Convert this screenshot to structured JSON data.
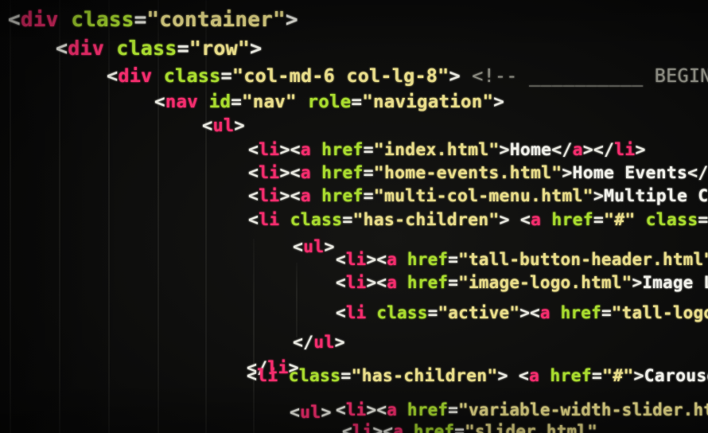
{
  "code_lines": [
    [
      [
        "br",
        "<"
      ],
      [
        "tag",
        "div"
      ],
      [
        "txt",
        " "
      ],
      [
        "attr",
        "class"
      ],
      [
        "br",
        "="
      ],
      [
        "str",
        "\"container\""
      ],
      [
        "br",
        ">"
      ]
    ],
    [
      [
        "br",
        "<"
      ],
      [
        "tag",
        "div"
      ],
      [
        "txt",
        " "
      ],
      [
        "attr",
        "class"
      ],
      [
        "br",
        "="
      ],
      [
        "str",
        "\"row\""
      ],
      [
        "br",
        ">"
      ]
    ],
    [
      [
        "br",
        "<"
      ],
      [
        "tag",
        "div"
      ],
      [
        "txt",
        " "
      ],
      [
        "attr",
        "class"
      ],
      [
        "br",
        "="
      ],
      [
        "str",
        "\"col-md-6 col-lg-8\""
      ],
      [
        "br",
        ">"
      ],
      [
        "txt",
        " "
      ],
      [
        "com",
        "<!-- __________ BEGIN NAVIGATION"
      ]
    ],
    [
      [
        "br",
        "<"
      ],
      [
        "tag",
        "nav"
      ],
      [
        "txt",
        " "
      ],
      [
        "attr",
        "id"
      ],
      [
        "br",
        "="
      ],
      [
        "str",
        "\"nav\""
      ],
      [
        "txt",
        " "
      ],
      [
        "attr",
        "role"
      ],
      [
        "br",
        "="
      ],
      [
        "str",
        "\"navigation\""
      ],
      [
        "br",
        ">"
      ]
    ],
    [
      [
        "br",
        "<"
      ],
      [
        "tag",
        "ul"
      ],
      [
        "br",
        ">"
      ]
    ],
    [
      [
        "br",
        "<"
      ],
      [
        "tag",
        "li"
      ],
      [
        "br",
        "><"
      ],
      [
        "tag",
        "a"
      ],
      [
        "txt",
        " "
      ],
      [
        "attr",
        "href"
      ],
      [
        "br",
        "="
      ],
      [
        "str",
        "\"index.html\""
      ],
      [
        "br",
        ">"
      ],
      [
        "txt",
        "Home"
      ],
      [
        "br",
        "</"
      ],
      [
        "tag",
        "a"
      ],
      [
        "br",
        "></"
      ],
      [
        "tag",
        "li"
      ],
      [
        "br",
        ">"
      ]
    ],
    [
      [
        "br",
        "<"
      ],
      [
        "tag",
        "li"
      ],
      [
        "br",
        "><"
      ],
      [
        "tag",
        "a"
      ],
      [
        "txt",
        " "
      ],
      [
        "attr",
        "href"
      ],
      [
        "br",
        "="
      ],
      [
        "str",
        "\"home-events.html\""
      ],
      [
        "br",
        ">"
      ],
      [
        "txt",
        "Home Events"
      ],
      [
        "br",
        "</"
      ],
      [
        "tag",
        "a"
      ],
      [
        "br",
        ">"
      ]
    ],
    [
      [
        "br",
        "<"
      ],
      [
        "tag",
        "li"
      ],
      [
        "br",
        "><"
      ],
      [
        "tag",
        "a"
      ],
      [
        "txt",
        " "
      ],
      [
        "attr",
        "href"
      ],
      [
        "br",
        "="
      ],
      [
        "str",
        "\"multi-col-menu.html\""
      ],
      [
        "br",
        ">"
      ],
      [
        "txt",
        "Multiple Col"
      ]
    ],
    [
      [
        "br",
        "<"
      ],
      [
        "tag",
        "li"
      ],
      [
        "txt",
        " "
      ],
      [
        "attr",
        "class"
      ],
      [
        "br",
        "="
      ],
      [
        "str",
        "\"has-children\""
      ],
      [
        "br",
        ">"
      ],
      [
        "txt",
        " "
      ],
      [
        "br",
        "<"
      ],
      [
        "tag",
        "a"
      ],
      [
        "txt",
        " "
      ],
      [
        "attr",
        "href"
      ],
      [
        "br",
        "="
      ],
      [
        "str",
        "\"#\""
      ],
      [
        "txt",
        " "
      ],
      [
        "attr",
        "class"
      ],
      [
        "br",
        "="
      ],
      [
        "str",
        "\"c"
      ]
    ],
    [
      [
        "br",
        "<"
      ],
      [
        "tag",
        "ul"
      ],
      [
        "br",
        ">"
      ]
    ],
    [
      [
        "br",
        "<"
      ],
      [
        "tag",
        "li"
      ],
      [
        "br",
        "><"
      ],
      [
        "tag",
        "a"
      ],
      [
        "txt",
        " "
      ],
      [
        "attr",
        "href"
      ],
      [
        "br",
        "="
      ],
      [
        "str",
        "\"tall-button-header.html\""
      ],
      [
        "br",
        ">"
      ]
    ],
    [
      [
        "br",
        "<"
      ],
      [
        "tag",
        "li"
      ],
      [
        "br",
        "><"
      ],
      [
        "tag",
        "a"
      ],
      [
        "txt",
        " "
      ],
      [
        "attr",
        "href"
      ],
      [
        "br",
        "="
      ],
      [
        "str",
        "\"image-logo.html\""
      ],
      [
        "br",
        ">"
      ],
      [
        "txt",
        "Image Lo"
      ]
    ],
    [
      [
        "br",
        "<"
      ],
      [
        "tag",
        "li"
      ],
      [
        "txt",
        " "
      ],
      [
        "attr",
        "class"
      ],
      [
        "br",
        "="
      ],
      [
        "str",
        "\"active\""
      ],
      [
        "br",
        "><"
      ],
      [
        "tag",
        "a"
      ],
      [
        "txt",
        " "
      ],
      [
        "attr",
        "href"
      ],
      [
        "br",
        "="
      ],
      [
        "str",
        "\"tall-logo."
      ]
    ],
    [
      [
        "br",
        "</"
      ],
      [
        "tag",
        "ul"
      ],
      [
        "br",
        ">"
      ]
    ],
    [
      [
        "br",
        "</"
      ],
      [
        "tag",
        "li"
      ],
      [
        "br",
        ">"
      ]
    ],
    [
      [
        "br",
        "<"
      ],
      [
        "tag",
        "li"
      ],
      [
        "txt",
        " "
      ],
      [
        "attr",
        "class"
      ],
      [
        "br",
        "="
      ],
      [
        "str",
        "\"has-children\""
      ],
      [
        "br",
        ">"
      ],
      [
        "txt",
        " "
      ],
      [
        "br",
        "<"
      ],
      [
        "tag",
        "a"
      ],
      [
        "txt",
        " "
      ],
      [
        "attr",
        "href"
      ],
      [
        "br",
        "="
      ],
      [
        "str",
        "\"#\""
      ],
      [
        "br",
        ">"
      ],
      [
        "txt",
        "Carousels"
      ]
    ],
    [
      [
        "br",
        "<"
      ],
      [
        "tag",
        "ul"
      ],
      [
        "br",
        ">"
      ]
    ],
    [
      [
        "br",
        "<"
      ],
      [
        "tag",
        "li"
      ],
      [
        "br",
        "><"
      ],
      [
        "tag",
        "a"
      ],
      [
        "txt",
        " "
      ],
      [
        "attr",
        "href"
      ],
      [
        "br",
        "="
      ],
      [
        "str",
        "\"variable-width-slider.html"
      ]
    ],
    [
      [
        "br",
        "<"
      ],
      [
        "tag",
        "li"
      ],
      [
        "br",
        "><"
      ],
      [
        "tag",
        "a"
      ],
      [
        "txt",
        " "
      ],
      [
        "attr",
        "href"
      ],
      [
        "br",
        "="
      ],
      [
        "str",
        "\"slider.html\""
      ]
    ]
  ]
}
